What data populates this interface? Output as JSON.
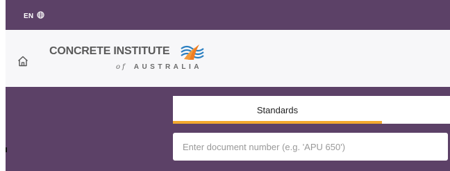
{
  "topbar": {
    "language": "EN",
    "language_icon": "globe-icon"
  },
  "header": {
    "home_icon": "home-icon",
    "logo": {
      "line1": "CONCRETE INSTITUTE",
      "of": "of",
      "line2": "AUSTRALIA"
    }
  },
  "tabs": [
    {
      "label": "Standards",
      "active": true
    }
  ],
  "search": {
    "placeholder": "Enter document number (e.g. 'APU 650')",
    "value": ""
  },
  "colors": {
    "brand_purple": "#5c4167",
    "accent_orange": "#f2a92f",
    "header_bg": "#f7f7f9"
  }
}
